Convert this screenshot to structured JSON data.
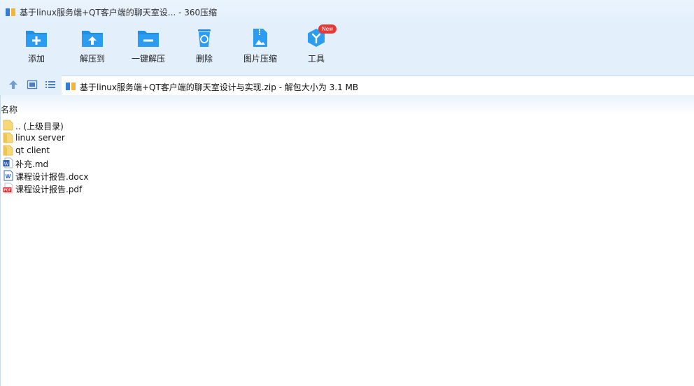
{
  "window": {
    "title": "基于linux服务端+QT客户端的聊天室设... - 360压缩"
  },
  "toolbar": {
    "items": [
      {
        "label": "添加",
        "icon": "add-folder-icon"
      },
      {
        "label": "解压到",
        "icon": "extract-to-icon"
      },
      {
        "label": "一键解压",
        "icon": "one-click-extract-icon"
      },
      {
        "label": "删除",
        "icon": "recycle-bin-icon"
      },
      {
        "label": "图片压缩",
        "icon": "image-compress-icon"
      },
      {
        "label": "工具",
        "icon": "tools-icon",
        "badge": "New"
      }
    ]
  },
  "address": {
    "path": "基于linux服务端+QT客户端的聊天室设计与实现.zip - 解包大小为 3.1 MB"
  },
  "list": {
    "header_name": "名称",
    "rows": [
      {
        "name": ".. (上级目录)",
        "icon": "parent-folder-icon"
      },
      {
        "name": "linux server",
        "icon": "folder-icon"
      },
      {
        "name": "qt client",
        "icon": "folder-icon"
      },
      {
        "name": "补充.md",
        "icon": "word-document-icon"
      },
      {
        "name": "课程设计报告.docx",
        "icon": "word-document-icon"
      },
      {
        "name": "课程设计报告.pdf",
        "icon": "pdf-document-icon"
      }
    ]
  },
  "colors": {
    "chrome": "#e3effb",
    "accent_blue": "#1e8fe6",
    "badge_red": "#e53935",
    "folder_yellow": "#f8d775",
    "pdf_red": "#d9262c",
    "word_blue": "#2b5cb5"
  }
}
